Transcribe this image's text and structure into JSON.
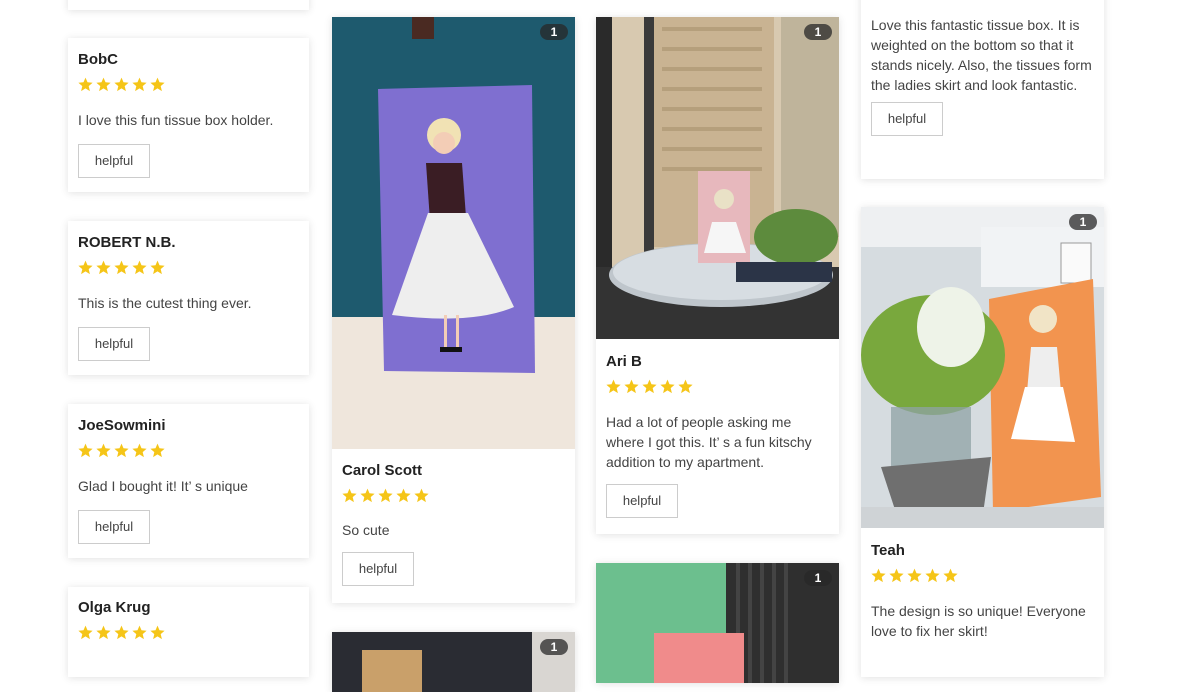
{
  "colors": {
    "star": "#f5c518",
    "accent": "#333333"
  },
  "helpful_label": "helpful",
  "reviews": {
    "bobc": {
      "name": "BobC",
      "rating": 5,
      "text": "I love this fun tissue box holder."
    },
    "robert": {
      "name": "ROBERT N.B.",
      "rating": 5,
      "text": "This is the cutest thing ever."
    },
    "joe": {
      "name": "JoeSowmini",
      "rating": 5,
      "text": "Glad I bought it! It’ s unique"
    },
    "olga": {
      "name": "Olga Krug",
      "rating": 5
    },
    "carol": {
      "name": "Carol Scott",
      "rating": 5,
      "text": "So cute",
      "photo_count": "1"
    },
    "carol_next": {
      "photo_count": "1"
    },
    "ari": {
      "name": "Ari B",
      "rating": 5,
      "text": "Had a lot of people asking me where I got this. It’ s a fun kitschy addition to my apartment.",
      "photo_count": "1"
    },
    "green": {
      "photo_count": "1"
    },
    "top_right": {
      "text": "Love this fantastic tissue box. It is weighted on the bottom so that it stands nicely. Also, the tissues form the ladies skirt and look fantastic."
    },
    "teah": {
      "name": "Teah",
      "rating": 5,
      "text": "The design is so unique! Everyone love to fix her skirt!",
      "photo_count": "1"
    }
  }
}
